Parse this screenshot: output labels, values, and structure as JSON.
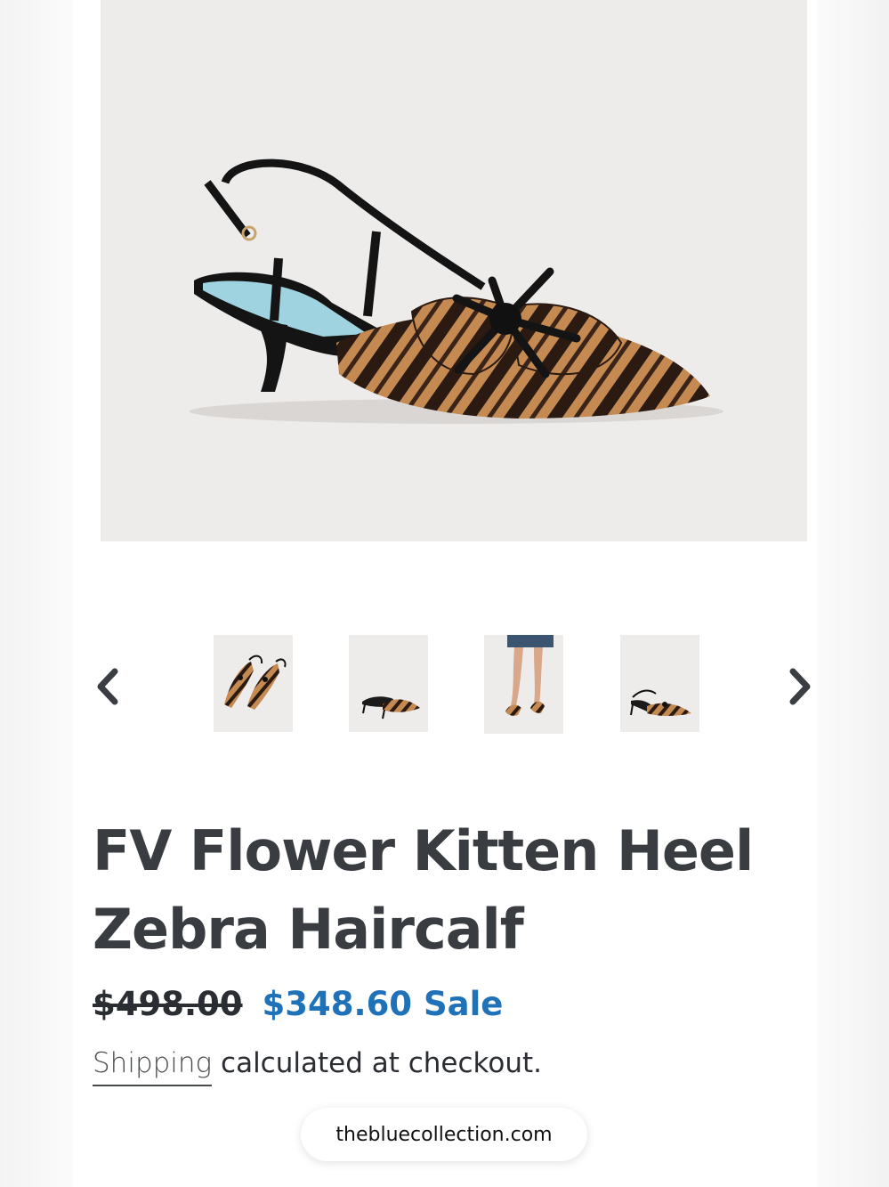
{
  "product": {
    "title_line1": "FV Flower Kitten Heel",
    "title_line2": "Zebra Haircalf",
    "original_price": "$498.00",
    "sale_price": "$348.60",
    "sale_label": "Sale",
    "shipping_link": "Shipping",
    "shipping_text": " calculated at checkout."
  },
  "gallery": {
    "prev_icon": "chevron-left-icon",
    "next_icon": "chevron-right-icon",
    "thumbnail_count": 4
  },
  "browser": {
    "url": "thebluecollection.com"
  },
  "colors": {
    "sale": "#1f72b8",
    "title": "#393d42",
    "image_bg": "#eeeceb"
  }
}
